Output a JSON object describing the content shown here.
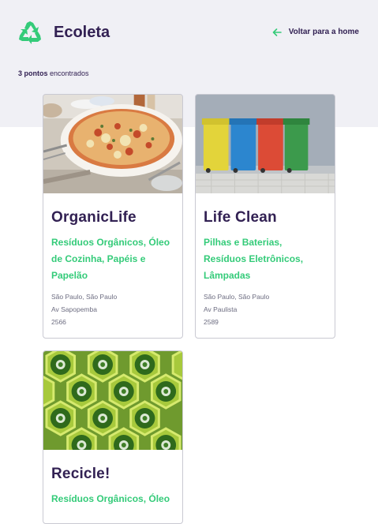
{
  "header": {
    "logo_text": "Ecoleta",
    "back_label": "Voltar para a home"
  },
  "results": {
    "count_bold": "3 pontos",
    "count_rest": " encontrados"
  },
  "colors": {
    "primary": "#34cb79",
    "title": "#322153",
    "band": "#f0f0f5"
  },
  "cards": [
    {
      "name": "OrganicLife",
      "items": "Resíduos Orgânicos, Óleo de Cozinha, Papéis e Papelão",
      "city": "São Paulo, São Paulo",
      "street": "Av Sapopemba",
      "number": "2566",
      "image": "pizza-photo"
    },
    {
      "name": "Life Clean",
      "items": "Pilhas e Baterias, Resíduos Eletrônicos, Lâmpadas",
      "city": "São Paulo, São Paulo",
      "street": "Av Paulista",
      "number": "2589",
      "image": "recycling-bins-photo"
    },
    {
      "name": "Recicle!",
      "items": "Resíduos Orgânicos, Óleo",
      "image": "glass-bottles-photo"
    }
  ]
}
